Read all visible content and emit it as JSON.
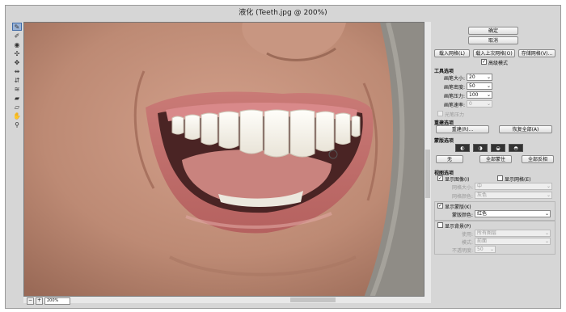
{
  "window": {
    "title": "液化 (Teeth.jpg @ 200%)"
  },
  "zoom": {
    "value": "200%"
  },
  "tools": [
    "forward-warp-icon",
    "reconstruct-icon",
    "twirl-icon",
    "pucker-icon",
    "bloat-icon",
    "push-left-icon",
    "mirror-icon",
    "turbulence-icon",
    "freeze-mask-icon",
    "thaw-mask-icon",
    "hand-icon",
    "zoom-icon"
  ],
  "panel": {
    "ok": "确定",
    "cancel": "取消",
    "load_mesh": "载入网格(L)",
    "load_last_mesh": "载入上次网格(O)",
    "save_mesh": "存储网格(V)...",
    "advanced_mode": "高级模式",
    "tool_options": {
      "title": "工具选项",
      "brush_size_label": "画笔大小:",
      "brush_size": "20",
      "brush_density_label": "画笔密度:",
      "brush_density": "50",
      "brush_pressure_label": "画笔压力:",
      "brush_pressure": "100",
      "brush_rate_label": "画笔速率:",
      "brush_rate": "0",
      "stylus_pressure": "光笔压力"
    },
    "reconstruct_options": {
      "title": "重建选项",
      "reconstruct": "重建(R)...",
      "restore_all": "恢复全部(A)"
    },
    "mask_options": {
      "title": "蒙版选项",
      "none": "无",
      "mask_all": "全部蒙住",
      "invert_all": "全部反相"
    },
    "view_options": {
      "title": "视图选项",
      "show_image": "显示图像(I)",
      "show_mesh": "显示网格(E)",
      "mesh_size_label": "网格大小:",
      "mesh_size": "中",
      "mesh_color_label": "网格颜色:",
      "mesh_color": "灰色",
      "show_mask": "显示蒙版(K)",
      "mask_color_label": "蒙版颜色:",
      "mask_color": "红色",
      "show_backdrop": "显示背景(P)",
      "use_label": "使用:",
      "use": "所有图层",
      "mode_label": "模式:",
      "mode": "前面",
      "opacity_label": "不透明度:",
      "opacity": "50"
    }
  }
}
